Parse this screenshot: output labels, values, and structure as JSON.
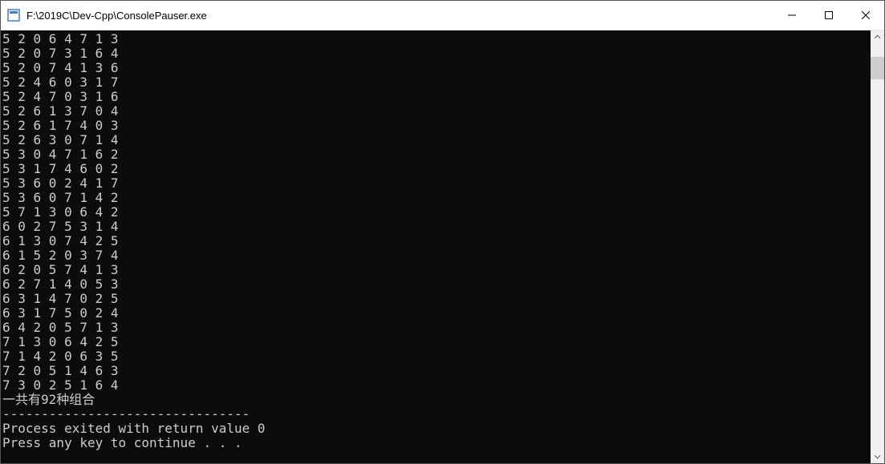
{
  "window": {
    "title": "F:\\2019C\\Dev-Cpp\\ConsolePauser.exe"
  },
  "console": {
    "lines": [
      "5 2 0 6 4 7 1 3",
      "5 2 0 7 3 1 6 4",
      "5 2 0 7 4 1 3 6",
      "5 2 4 6 0 3 1 7",
      "5 2 4 7 0 3 1 6",
      "5 2 6 1 3 7 0 4",
      "5 2 6 1 7 4 0 3",
      "5 2 6 3 0 7 1 4",
      "5 3 0 4 7 1 6 2",
      "5 3 1 7 4 6 0 2",
      "5 3 6 0 2 4 1 7",
      "5 3 6 0 7 1 4 2",
      "5 7 1 3 0 6 4 2",
      "6 0 2 7 5 3 1 4",
      "6 1 3 0 7 4 2 5",
      "6 1 5 2 0 3 7 4",
      "6 2 0 5 7 4 1 3",
      "6 2 7 1 4 0 5 3",
      "6 3 1 4 7 0 2 5",
      "6 3 1 7 5 0 2 4",
      "6 4 2 0 5 7 1 3",
      "7 1 3 0 6 4 2 5",
      "7 1 4 2 0 6 3 5",
      "7 2 0 5 1 4 6 3",
      "7 3 0 2 5 1 6 4"
    ],
    "summary": "一共有92种组合",
    "separator": "--------------------------------",
    "exit_message": "Process exited with return value 0",
    "prompt": "Press any key to continue . . ."
  }
}
